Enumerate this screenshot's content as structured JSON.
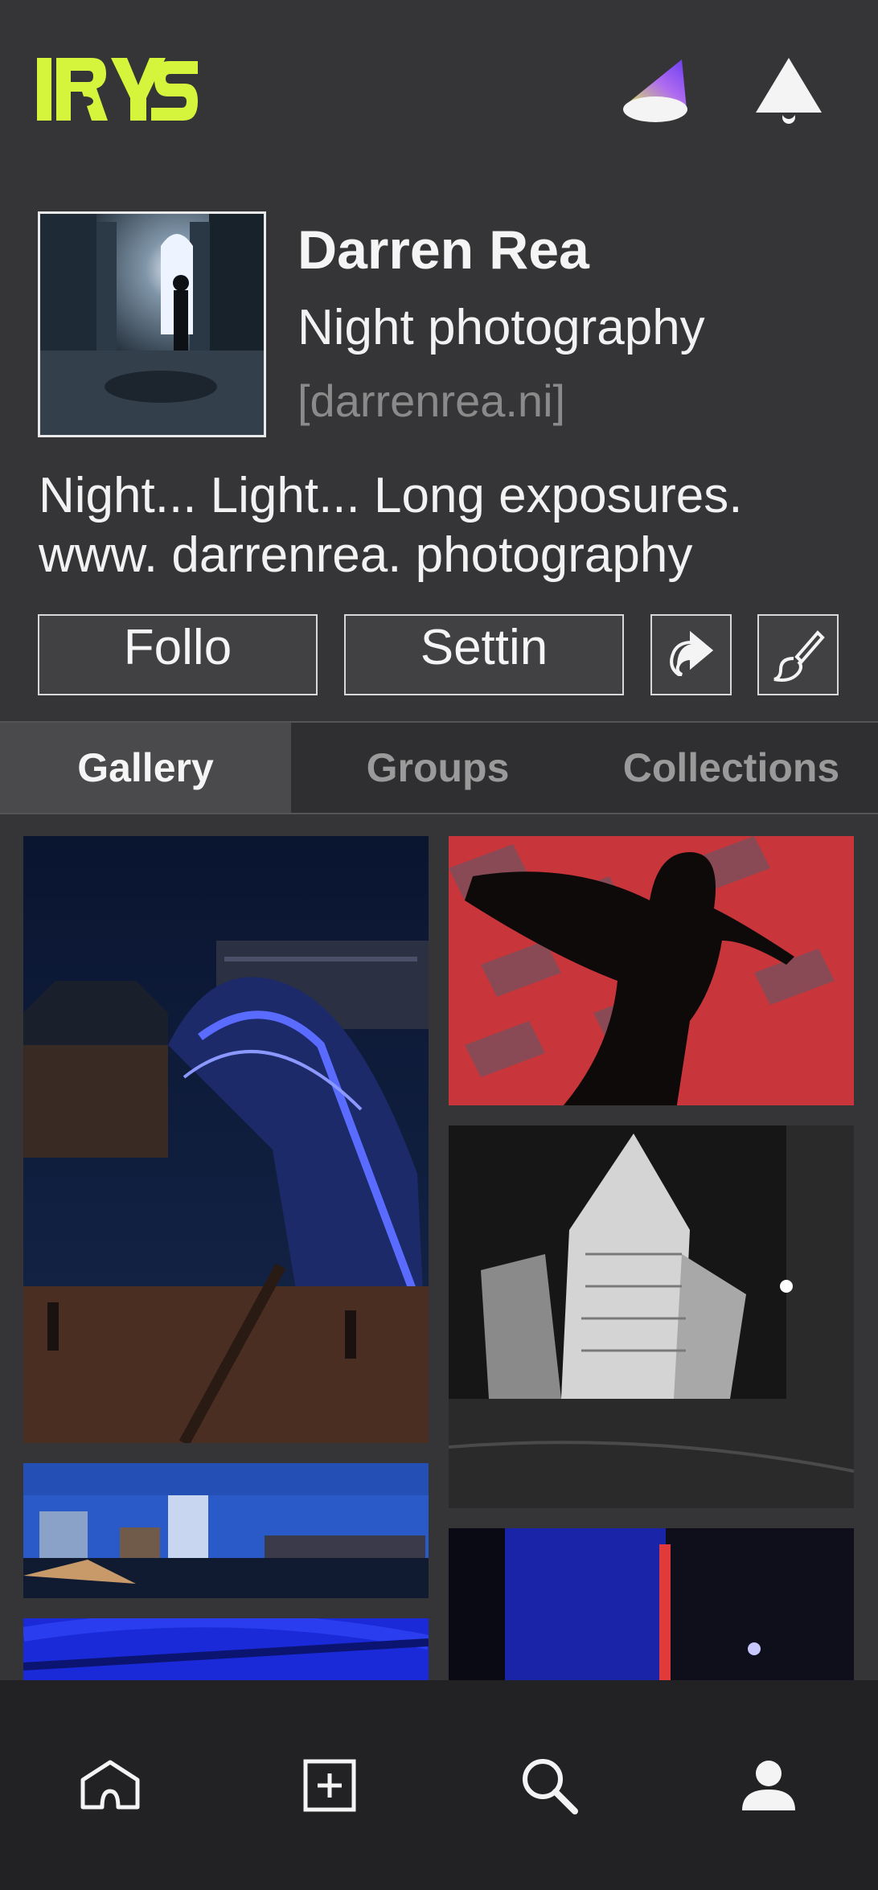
{
  "header": {
    "logo_icon": "irys-logo",
    "icons": [
      "gradient-cone-icon",
      "notification-bell-icon"
    ]
  },
  "profile": {
    "name": "Darren Rea",
    "subtitle": "Night photography",
    "website": "[darrenrea.ni]",
    "bio_line1": "Night... Light... Long exposures.",
    "bio_line2": "www. darrenrea. photography"
  },
  "actions": {
    "follow_label": "Follo",
    "settings_label": "Settin",
    "share_icon": "share-icon",
    "edit_icon": "edit-brush-icon"
  },
  "tabs": [
    {
      "label": "Gallery",
      "active": true
    },
    {
      "label": "Groups",
      "active": false
    },
    {
      "label": "Collections",
      "active": false
    }
  ],
  "gallery": {
    "photos": [
      "bridge-night-photo",
      "dancer-silhouette-photo",
      "titanic-building-photo",
      "harbour-panorama-photo",
      "blue-bridge-photo",
      "neon-alley-photo"
    ]
  },
  "bottom_nav": [
    "home-icon",
    "add-post-icon",
    "search-icon",
    "profile-icon"
  ],
  "colors": {
    "background": "#353537",
    "accent_logo": "#d4f53c",
    "nav_background": "#222224"
  }
}
